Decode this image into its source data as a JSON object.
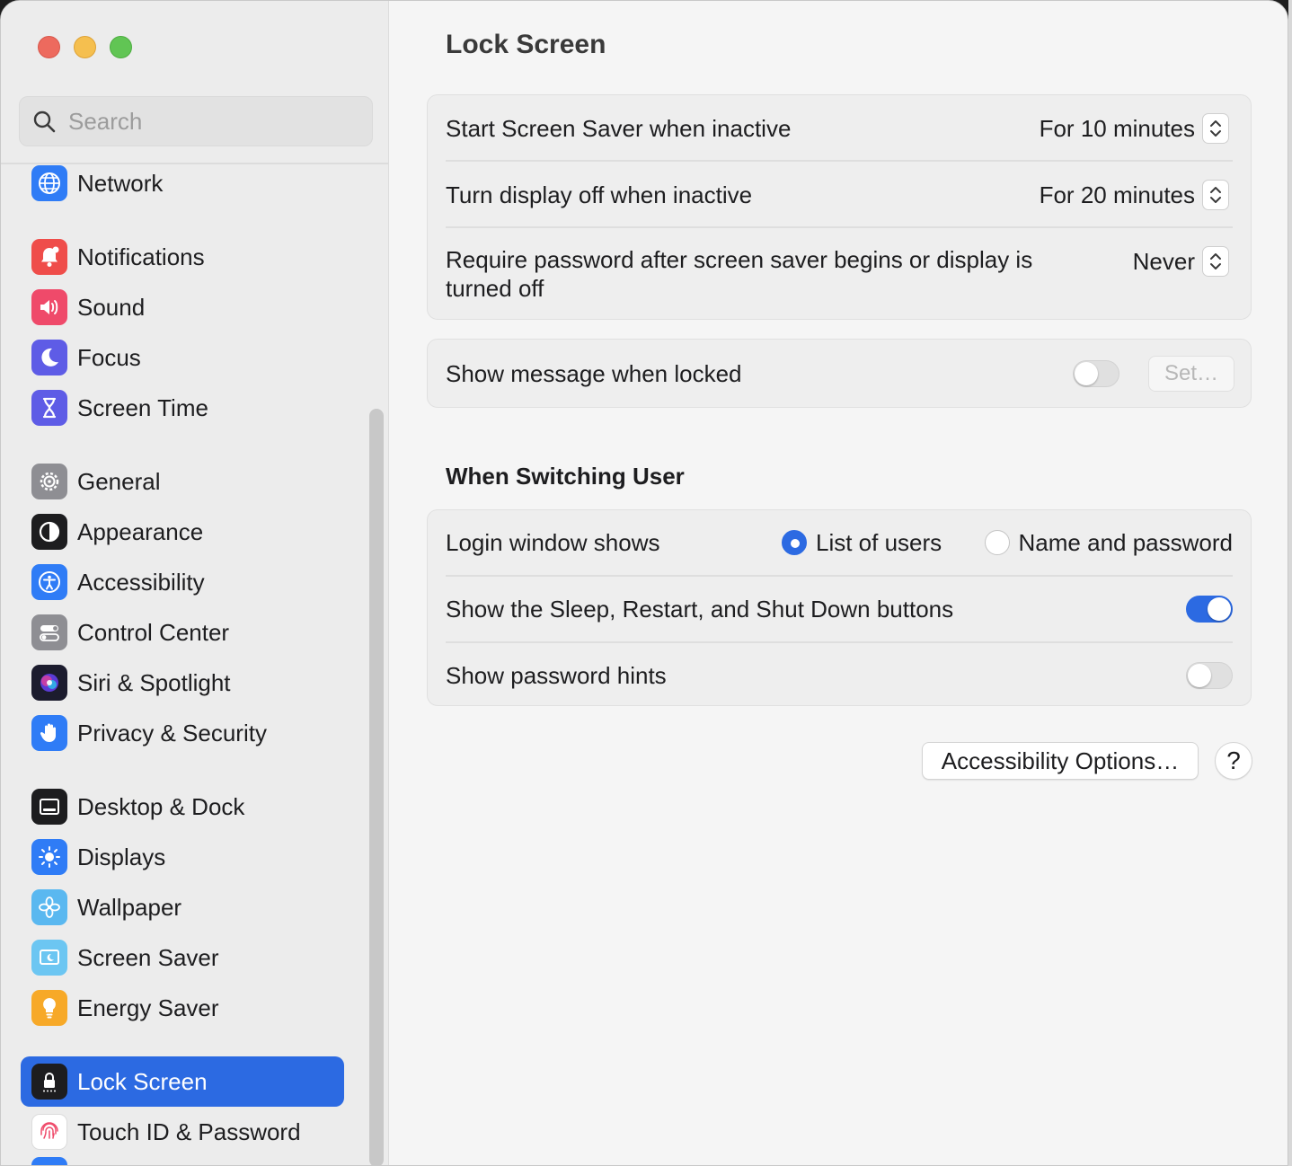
{
  "search": {
    "placeholder": "Search"
  },
  "sidebar": {
    "items": [
      {
        "label": "Network",
        "icon": "globe-icon",
        "color": "#2f7cf6"
      },
      {
        "label": "Notifications",
        "icon": "bell-icon",
        "color": "#ef4d4a"
      },
      {
        "label": "Sound",
        "icon": "speaker-icon",
        "color": "#ef4a6a"
      },
      {
        "label": "Focus",
        "icon": "moon-icon",
        "color": "#5e5ce6"
      },
      {
        "label": "Screen Time",
        "icon": "hourglass-icon",
        "color": "#5e5ce6"
      },
      {
        "label": "General",
        "icon": "gear-icon",
        "color": "#8e8e93"
      },
      {
        "label": "Appearance",
        "icon": "appearance-icon",
        "color": "#1d1d1f"
      },
      {
        "label": "Accessibility",
        "icon": "accessibility-icon",
        "color": "#2f7cf6"
      },
      {
        "label": "Control Center",
        "icon": "switches-icon",
        "color": "#8e8e93"
      },
      {
        "label": "Siri & Spotlight",
        "icon": "siri-icon",
        "color": "#5b3bd6"
      },
      {
        "label": "Privacy & Security",
        "icon": "hand-icon",
        "color": "#2f7cf6"
      },
      {
        "label": "Desktop & Dock",
        "icon": "dock-icon",
        "color": "#1d1d1f"
      },
      {
        "label": "Displays",
        "icon": "sun-icon",
        "color": "#2f7cf6"
      },
      {
        "label": "Wallpaper",
        "icon": "flower-icon",
        "color": "#5ab8f0"
      },
      {
        "label": "Screen Saver",
        "icon": "screensaver-icon",
        "color": "#6cc6f2"
      },
      {
        "label": "Energy Saver",
        "icon": "bulb-icon",
        "color": "#f7a928"
      },
      {
        "label": "Lock Screen",
        "icon": "lock-icon",
        "color": "#1d1d1f"
      },
      {
        "label": "Touch ID & Password",
        "icon": "fingerprint-icon",
        "color": "#ffffff"
      }
    ]
  },
  "main": {
    "title": "Lock Screen",
    "screen_saver": {
      "label": "Start Screen Saver when inactive",
      "value": "For 10 minutes"
    },
    "display_off": {
      "label": "Turn display off when inactive",
      "value": "For 20 minutes"
    },
    "require_password": {
      "label": "Require password after screen saver begins or display is turned off",
      "value": "Never"
    },
    "show_message": {
      "label": "Show message when locked",
      "enabled": false,
      "set_button": "Set…"
    },
    "switching_title": "When Switching User",
    "login_window": {
      "label": "Login window shows",
      "option1": "List of users",
      "option2": "Name and password",
      "selected": "List of users"
    },
    "sleep_buttons": {
      "label": "Show the Sleep, Restart, and Shut Down buttons",
      "enabled": true
    },
    "password_hints": {
      "label": "Show password hints",
      "enabled": false
    },
    "accessibility_button": "Accessibility Options…",
    "help_button": "?"
  },
  "colors": {
    "accent": "#2c6ae2",
    "sidebar_bg": "#ececec",
    "content_bg": "#f5f5f5"
  }
}
